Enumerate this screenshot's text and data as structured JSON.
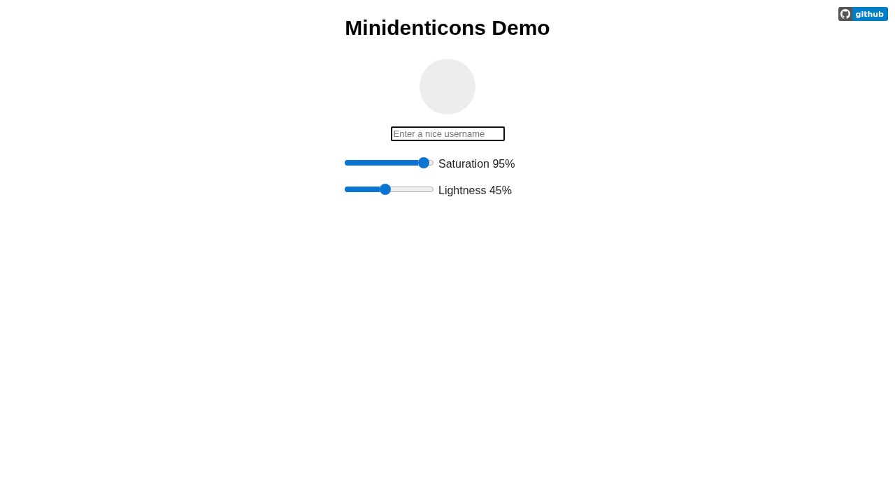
{
  "badge": {
    "label": "github"
  },
  "title": "Minidenticons Demo",
  "username_field": {
    "placeholder": "Enter a nice username",
    "focused": true
  },
  "sliders": [
    {
      "label": "Saturation 95%",
      "level": 0.95
    },
    {
      "label": "Lightness 45%",
      "level": 0.45
    }
  ]
}
